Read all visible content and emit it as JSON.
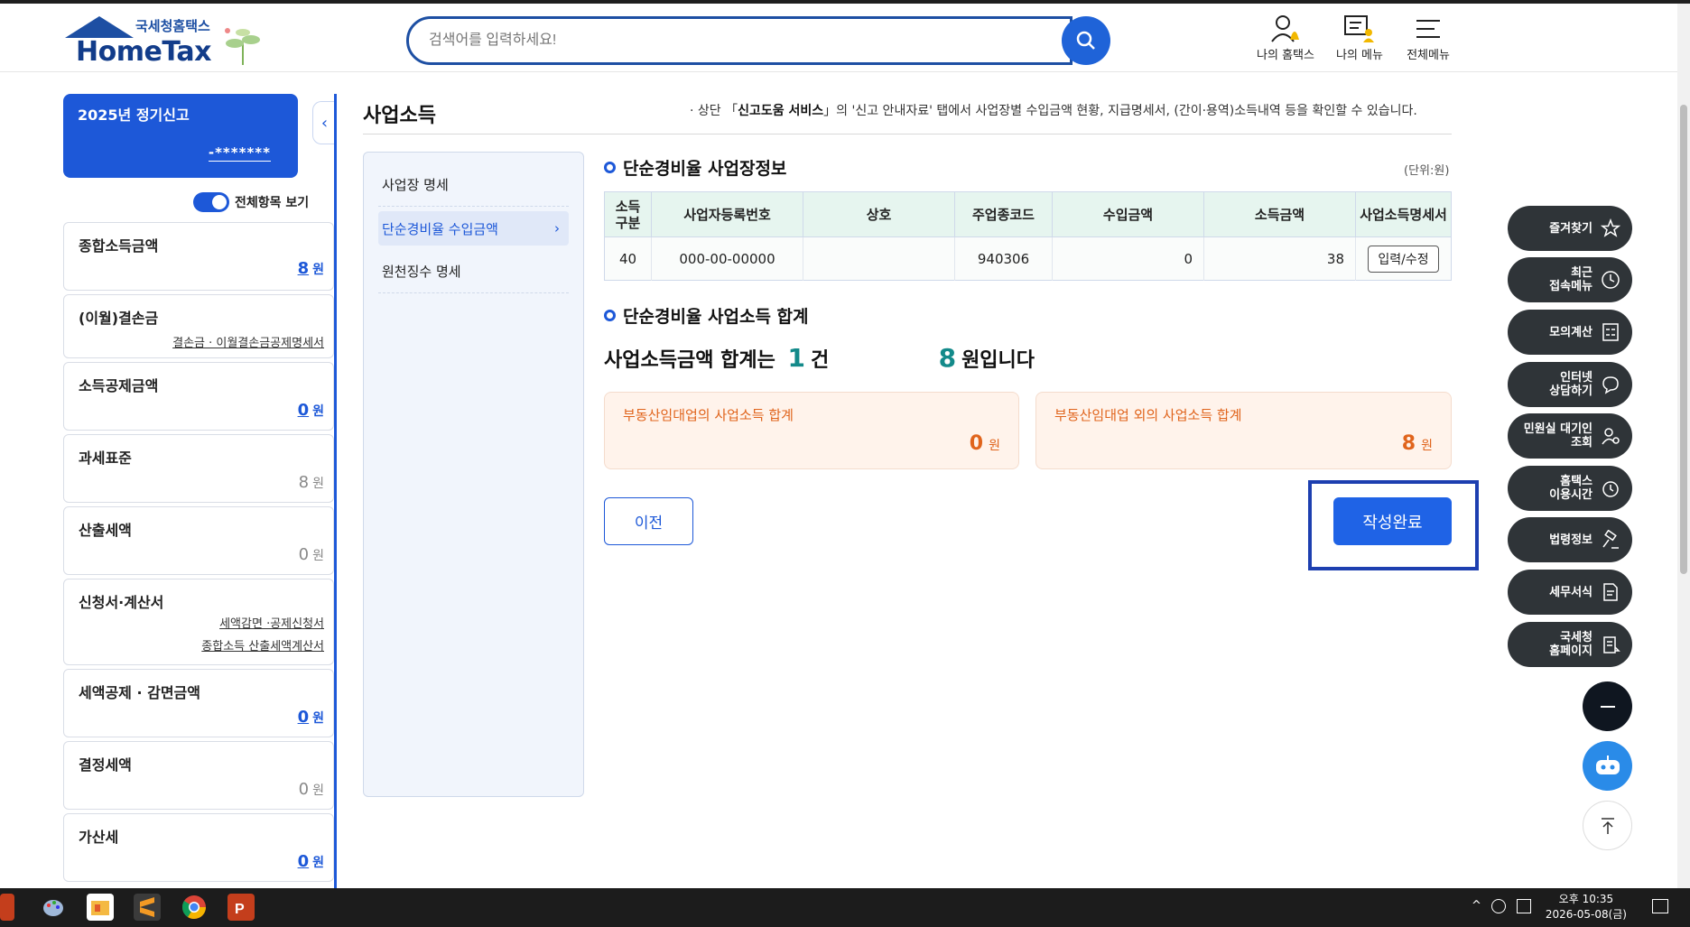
{
  "header": {
    "logo_sub": "국세청홈택스",
    "logo_main": "HomeTax",
    "search_placeholder": "검색어를 입력하세요!",
    "tools": [
      "나의 홈택스",
      "나의 메뉴",
      "전체메뉴"
    ]
  },
  "left": {
    "filing_title": "2025년 정기신고",
    "filing_id": "-*******",
    "toggle_label": "전체항목 보기",
    "items": [
      {
        "label": "종합소득금액",
        "value": "8",
        "unit": "원"
      },
      {
        "label": "(이월)결손금",
        "link": "결손금 · 이월결손금공제명세서"
      },
      {
        "label": "소득공제금액",
        "value": "0",
        "unit": "원"
      },
      {
        "label": "과세표준",
        "value": "8",
        "unit": "원"
      },
      {
        "label": "산출세액",
        "value": "0",
        "unit": "원"
      },
      {
        "label": "신청서·계산서",
        "link1": "세액감면 ·공제신청서",
        "link2": "종합소득 산출세액계산서"
      },
      {
        "label": "세액공제 · 감면금액",
        "value": "0",
        "unit": "원"
      },
      {
        "label": "결정세액",
        "value": "0",
        "unit": "원"
      },
      {
        "label": "가산세",
        "value": "0",
        "unit": "원"
      }
    ]
  },
  "main": {
    "title": "사업소득",
    "notice_pre": "· 상단 「",
    "notice_bold": "신고도움 서비스",
    "notice_post": "」의 '신고 안내자료' 탭에서 사업장별 수입금액 현황, 지급명세서, (간이·용역)소득내역 등을 확인할 수 있습니다.",
    "submenu": [
      "사업장 명세",
      "단순경비율 수입금액",
      "원천징수 명세"
    ],
    "section1": "단순경비율 사업장정보",
    "unit": "(단위:원)",
    "table": {
      "headers": [
        "소득\n구분",
        "사업자등록번호",
        "상호",
        "주업종코드",
        "수입금액",
        "소득금액",
        "사업소득명세서"
      ],
      "row": [
        "40",
        "000-00-00000",
        "",
        "940306",
        "0",
        "38",
        "입력/수정"
      ]
    },
    "section2": "단순경비율 사업소득 합계",
    "total_prefix": "사업소득금액 합계는",
    "total_count": "1",
    "total_count_unit": "건",
    "total_amount": "8",
    "total_amount_unit": "원입니다",
    "box1_title": "부동산임대업의 사업소득 합계",
    "box1_value": "0",
    "box2_title": "부동산임대업 외의 사업소득 합계",
    "box2_value": "8",
    "won": "원",
    "prev_label": "이전",
    "done_label": "작성완료"
  },
  "float_menu": [
    "즐겨찾기",
    "최근\n접속메뉴",
    "모의계산",
    "인터넷\n상담하기",
    "민원실 대기인\n조회",
    "홈택스\n이용시간",
    "법령정보",
    "세무서식",
    "국세청\n홈페이지"
  ],
  "taskbar": {
    "time": "오후 10:35",
    "date": "2026-05-08(금)"
  },
  "colors": {
    "accent": "#1d58d8",
    "dark_button": "#2f3438",
    "summary_orange": "#e0641c",
    "highlight_frame": "#1d3fb0"
  }
}
